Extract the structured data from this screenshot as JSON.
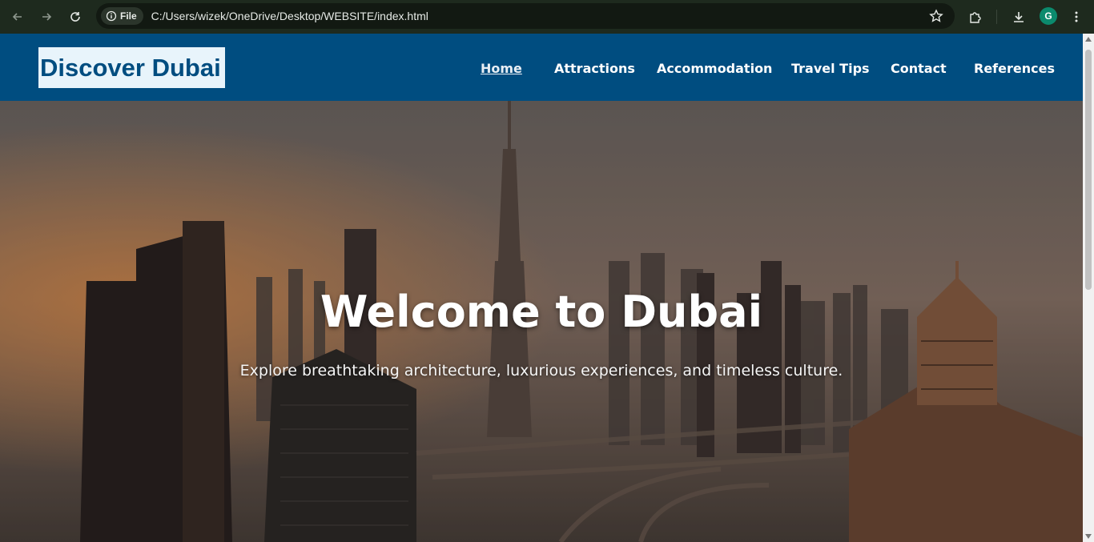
{
  "browser": {
    "back_icon": "arrow-left-icon",
    "forward_icon": "arrow-right-icon",
    "reload_icon": "reload-icon",
    "site_chip_label": "File",
    "url": "C:/Users/wizek/OneDrive/Desktop/WEBSITE/index.html",
    "bookmark_icon": "star-icon",
    "extensions_icon": "puzzle-icon",
    "download_icon": "download-icon",
    "profile_initial": "G",
    "menu_icon": "kebab-menu-icon"
  },
  "header": {
    "logo_text": "Discover Dubai",
    "nav": [
      {
        "label": "Home",
        "active": true
      },
      {
        "label": "Attractions",
        "active": false
      },
      {
        "label": "Accommodation",
        "active": false
      },
      {
        "label": "Travel Tips",
        "active": false
      },
      {
        "label": "Contact",
        "active": false
      },
      {
        "label": "References",
        "active": false
      }
    ]
  },
  "hero": {
    "title": "Welcome to Dubai",
    "subtitle": "Explore breathtaking architecture, luxurious experiences, and timeless culture."
  },
  "colors": {
    "header_bg": "#004d80",
    "logo_bg": "#e8f4fb",
    "browser_bg": "#1e2a1e",
    "profile_bg": "#0b8a6d"
  }
}
